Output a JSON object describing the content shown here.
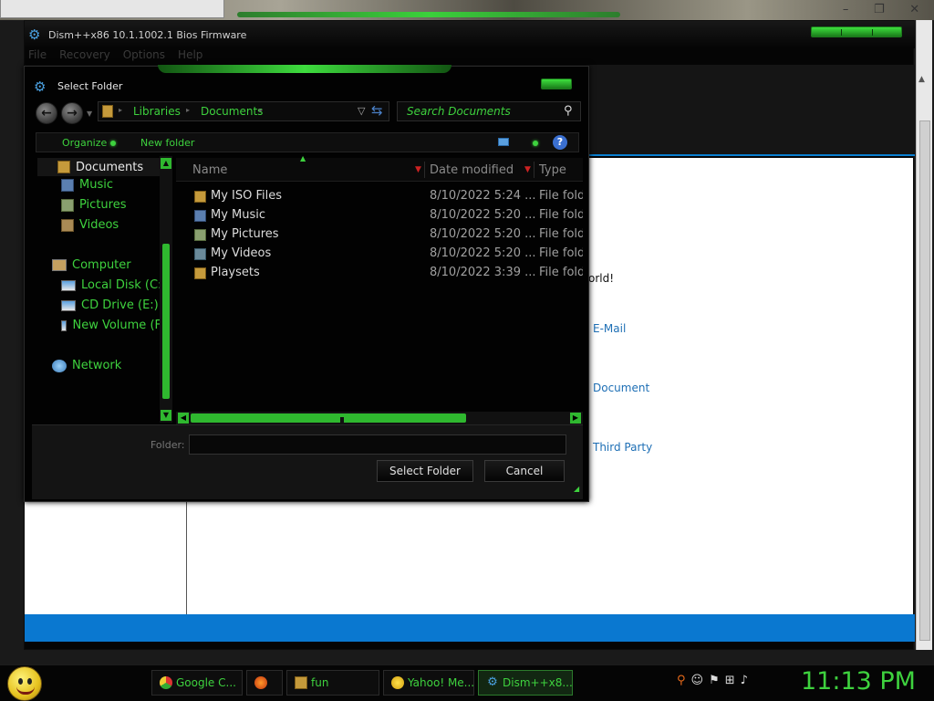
{
  "dism_window": {
    "title": "Dism++x86 10.1.1002.1 Bios Firmware",
    "menu": [
      "File",
      "Recovery",
      "Options",
      "Help"
    ],
    "content_fragments": [
      "orld!",
      "E-Mail",
      "Document",
      "Third Party"
    ]
  },
  "dialog": {
    "title": "Select Folder",
    "breadcrumb": [
      "Libraries",
      "Documents"
    ],
    "search_placeholder": "Search Documents",
    "toolbar": {
      "organize": "Organize",
      "new_folder": "New folder"
    },
    "nav": {
      "libraries": [
        "Documents",
        "Music",
        "Pictures",
        "Videos"
      ],
      "computer": "Computer",
      "drives": [
        "Local Disk (C:)",
        "CD Drive (E:)",
        "New Volume (F"
      ],
      "network": "Network"
    },
    "columns": {
      "name": "Name",
      "date": "Date modified",
      "type": "Type"
    },
    "files": [
      {
        "name": "My ISO Files",
        "date": "8/10/2022 5:24 ...",
        "type": "File fold",
        "icon": "folder"
      },
      {
        "name": "My Music",
        "date": "8/10/2022 5:20 ...",
        "type": "File fold",
        "icon": "music"
      },
      {
        "name": "My Pictures",
        "date": "8/10/2022 5:20 ...",
        "type": "File fold",
        "icon": "pics"
      },
      {
        "name": "My Videos",
        "date": "8/10/2022 5:20 ...",
        "type": "File fold",
        "icon": "vids"
      },
      {
        "name": "Playsets",
        "date": "8/10/2022 3:39 ...",
        "type": "File fold",
        "icon": "folder"
      }
    ],
    "folder_label": "Folder:",
    "folder_value": "",
    "buttons": {
      "select": "Select Folder",
      "cancel": "Cancel"
    }
  },
  "taskbar": {
    "items": [
      {
        "label": "Google C...",
        "icon": "chrome"
      },
      {
        "label": "",
        "icon": "firefox"
      },
      {
        "label": "fun",
        "icon": "folder"
      },
      {
        "label": "Yahoo! Me...",
        "icon": "yahoo"
      },
      {
        "label": "Dism++x8...",
        "icon": "dism"
      }
    ],
    "clock": "11:13 PM"
  },
  "colors": {
    "accent_green": "#3ed23e",
    "accent_blue": "#0a78d0"
  }
}
